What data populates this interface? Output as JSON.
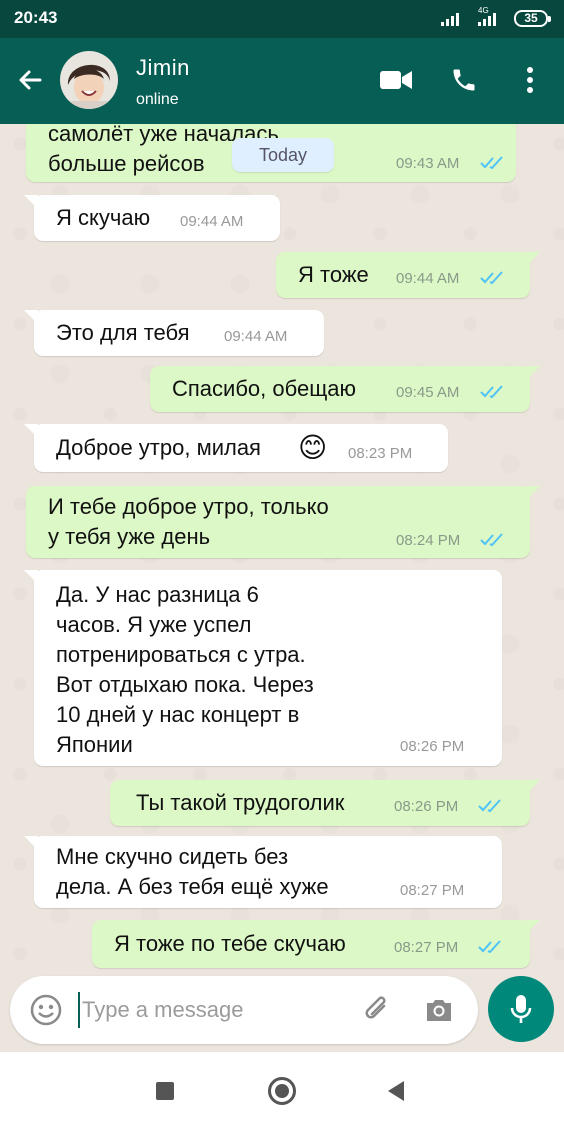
{
  "status_bar": {
    "time": "20:43",
    "network": "4G",
    "battery": "35"
  },
  "header": {
    "name": "Jimin",
    "status": "online"
  },
  "date_chip": "Today",
  "messages": [
    {
      "dir": "out",
      "text": "самолёт уже началась\nбольше рейсов",
      "time": "09:43 AM"
    },
    {
      "dir": "in",
      "text": "Я скучаю",
      "time": "09:44 AM"
    },
    {
      "dir": "out",
      "text": "Я тоже",
      "time": "09:44 AM"
    },
    {
      "dir": "in",
      "text": "Это для тебя",
      "time": "09:44 AM"
    },
    {
      "dir": "out",
      "text": "Спасибо, обещаю",
      "time": "09:45 AM"
    },
    {
      "dir": "in",
      "text": "Доброе утро, милая",
      "emoji": "😊",
      "time": "08:23 PM"
    },
    {
      "dir": "out",
      "text": "И тебе доброе утро, только\nу тебя уже день",
      "time": "08:24 PM"
    },
    {
      "dir": "in",
      "text": "Да. У нас разница 6\nчасов. Я уже успел\nпотренироваться с утра.\nВот отдыхаю пока. Через\n10 дней у нас концерт в\nЯпонии",
      "time": "08:26 PM"
    },
    {
      "dir": "out",
      "text": "Ты такой трудоголик",
      "time": "08:26 PM"
    },
    {
      "dir": "in",
      "text": "Мне скучно сидеть без\nдела. А без тебя ещё хуже",
      "time": "08:27 PM"
    },
    {
      "dir": "out",
      "text": "Я тоже по тебе скучаю",
      "time": "08:27 PM"
    }
  ],
  "composer": {
    "placeholder": "Type a message"
  },
  "colors": {
    "header": "#075e54",
    "status_bar": "#07473d",
    "outgoing": "#dcf8c6",
    "incoming": "#ffffff",
    "read_tick": "#4fc3f7",
    "mic": "#00897b"
  }
}
